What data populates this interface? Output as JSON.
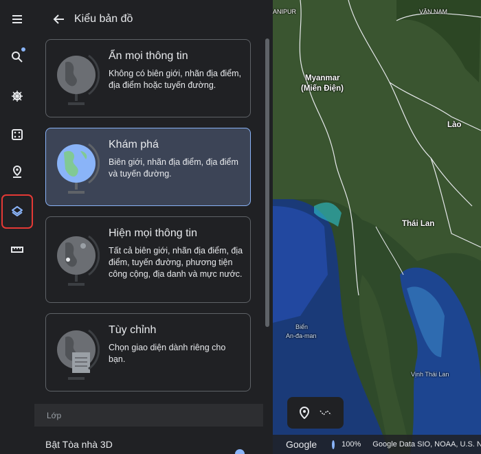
{
  "panel": {
    "title": "Kiểu bản đồ",
    "cards": [
      {
        "title": "Ẩn mọi thông tin",
        "desc": "Không có biên giới, nhãn địa điểm, địa điểm hoặc tuyến đường."
      },
      {
        "title": "Khám phá",
        "desc": "Biên giới, nhãn địa điểm, địa điểm và tuyến đường."
      },
      {
        "title": "Hiện mọi thông tin",
        "desc": "Tất cả biên giới, nhãn địa điểm, địa điểm, tuyến đường, phương tiện công cộng, địa danh và mực nước."
      },
      {
        "title": "Tùy chỉnh",
        "desc": "Chọn giao diện dành riêng cho bạn."
      }
    ],
    "section_label": "Lớp",
    "layer_3d": "Bật Tòa nhà 3D"
  },
  "map": {
    "labels": {
      "manipur": "ANIPUR",
      "vietnam": "VÂN NAM",
      "myanmar": "Myanmar",
      "myanmar_alt": "(Miến Điện)",
      "laos": "Lào",
      "thailand": "Thái Lan",
      "andaman_1": "Biển",
      "andaman_2": "An-đa-man",
      "gulf": "Vịnh Thái Lan"
    },
    "footer": {
      "brand": "Google",
      "zoom": "100%",
      "credit": "Google   Data SIO, NOAA, U.S. Na"
    }
  },
  "colors": {
    "accent": "#8ab4f8",
    "highlight": "#e53935"
  }
}
